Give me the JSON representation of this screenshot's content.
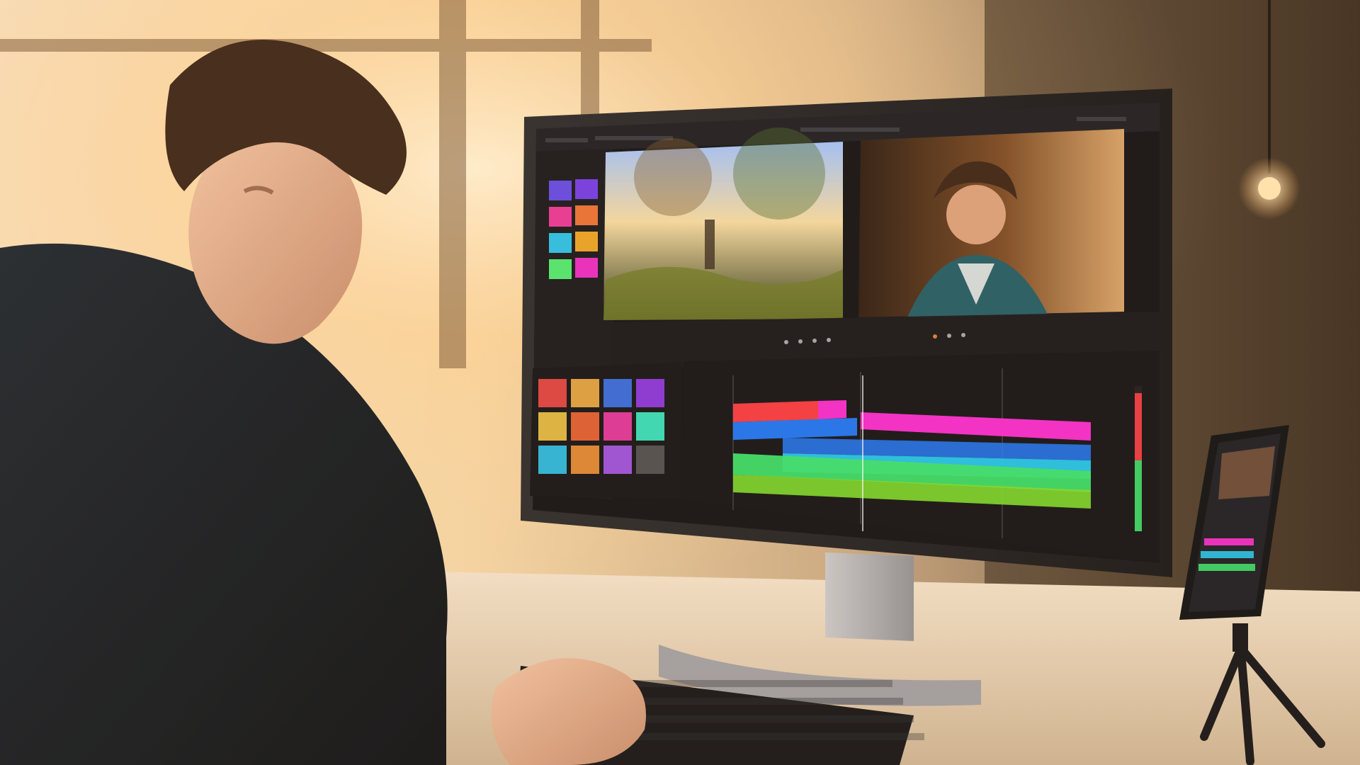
{
  "scene": {
    "colors": {
      "sunlight": "#ffd59a",
      "wall": "#3a2a1c",
      "desk": "#e9d3b6",
      "ui_panel": "#1a1b22",
      "ui_dark": "#121318",
      "clip_red": "#ff3b46",
      "clip_magenta": "#ff2bd6",
      "clip_blue": "#1c78ff",
      "clip_cyan": "#20c9f2",
      "clip_green": "#39e06b",
      "clip_lime": "#7bdc2c"
    },
    "icons": [
      "monitor-icon",
      "keyboard-icon",
      "phone-icon",
      "tripod-icon",
      "lamp-icon"
    ]
  }
}
